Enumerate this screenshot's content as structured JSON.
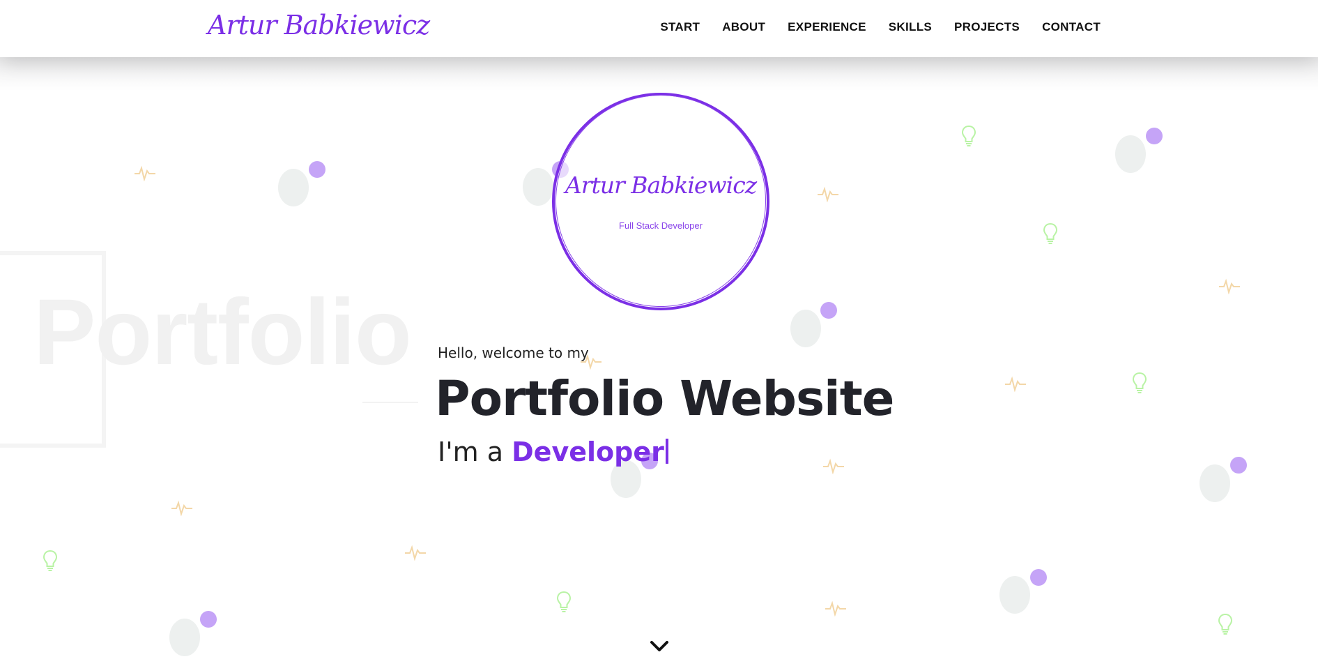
{
  "header": {
    "brand": "Artur Babkiewicz",
    "nav": [
      "START",
      "ABOUT",
      "EXPERIENCE",
      "SKILLS",
      "PROJECTS",
      "CONTACT"
    ]
  },
  "background": {
    "word": "Portfolio"
  },
  "logo": {
    "name": "Artur Babkiewicz",
    "role": "Full Stack Developer"
  },
  "hero": {
    "greeting": "Hello, welcome to my",
    "title": "Portfolio Website",
    "prefix": "I'm a",
    "role": "Developer"
  },
  "icons": {
    "scroll": "chevron-down-icon",
    "pulse": "pulse-icon",
    "bulb": "lightbulb-icon"
  },
  "colors": {
    "accent": "#7b2fe6",
    "dot": "#c5a4f7",
    "blob": "#edf0ef",
    "pulse": "#f3d7a8",
    "bulb": "#b9f3a5",
    "title": "#22232a"
  }
}
